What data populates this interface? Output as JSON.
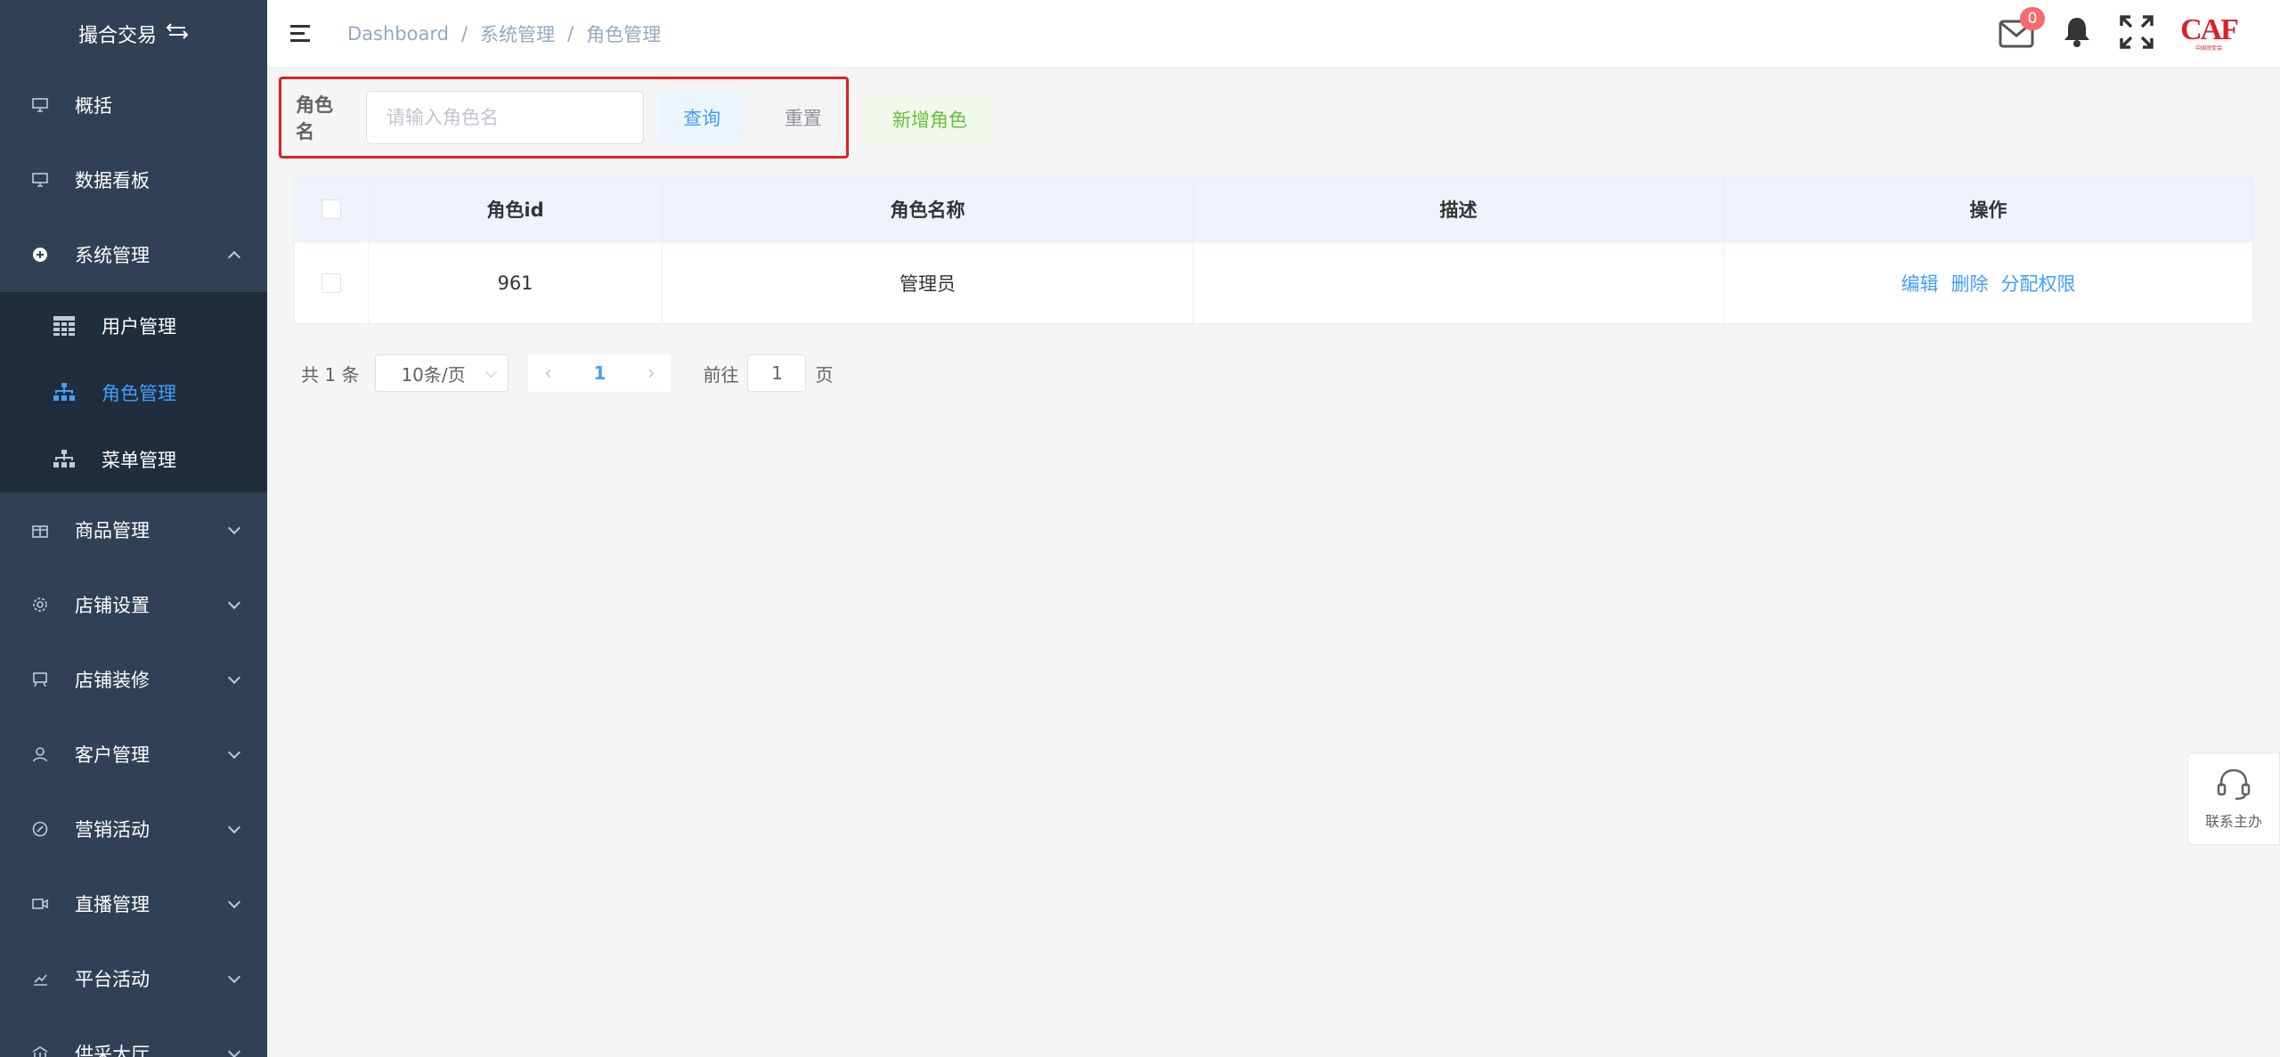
{
  "sidebar": {
    "brand_title": "撮合交易",
    "items": [
      {
        "label": "概括"
      },
      {
        "label": "数据看板"
      },
      {
        "label": "系统管理"
      },
      {
        "label": "商品管理"
      },
      {
        "label": "店铺设置"
      },
      {
        "label": "店铺装修"
      },
      {
        "label": "客户管理"
      },
      {
        "label": "营销活动"
      },
      {
        "label": "直播管理"
      },
      {
        "label": "平台活动"
      },
      {
        "label": "供采大厅"
      }
    ],
    "submenu": [
      {
        "label": "用户管理"
      },
      {
        "label": "角色管理"
      },
      {
        "label": "菜单管理"
      }
    ],
    "active_color": "#409eff",
    "bg_color": "#304156"
  },
  "header": {
    "breadcrumb": [
      "Dashboard",
      "系统管理",
      "角色管理"
    ],
    "breadcrumb_sep": "/",
    "mail_badge": "0",
    "logo_text": "CAF",
    "logo_sub": "中国贸促会"
  },
  "search": {
    "label": "角色名",
    "placeholder": "请输入角色名",
    "query_label": "查询",
    "reset_label": "重置",
    "add_label": "新增角色"
  },
  "table": {
    "columns": [
      "角色id",
      "角色名称",
      "描述",
      "操作"
    ],
    "rows": [
      {
        "id": "961",
        "name": "管理员",
        "desc": ""
      }
    ],
    "actions": [
      "编辑",
      "删除",
      "分配权限"
    ]
  },
  "pagination": {
    "total": "共 1 条",
    "page_size": "10条/页",
    "current": "1",
    "goto_label": "前往",
    "goto_value": "1",
    "page_suffix": "页"
  },
  "help": {
    "label": "联系主办"
  }
}
